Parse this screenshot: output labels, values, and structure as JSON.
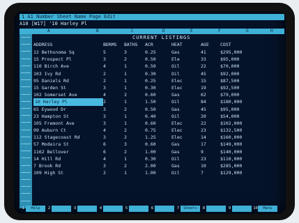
{
  "status_line": "1 A1  Number  Sheet  Name  Page  Edit",
  "cell_ref": "A10  [W17]  '10 Harley Pl",
  "columns": [
    "A",
    "B",
    "C",
    "D",
    "E",
    "F",
    "G",
    "H"
  ],
  "title": "CURRENT LISTINGS",
  "headers": [
    "ADDRESS",
    "BDRMS",
    "BATHS",
    "ACR",
    "HEAT",
    "AGE",
    "COST"
  ],
  "rows": [
    [
      "12 Bethsnoma Sq",
      "5",
      "3",
      "0.25",
      "Gas",
      "41",
      "$295,000"
    ],
    [
      "15 Prospect Pl",
      "3",
      "2",
      "0.50",
      "Ele",
      "33",
      "$95,000"
    ],
    [
      "110 Birch Ave",
      "4",
      "1",
      "0.50",
      "Oil",
      "22",
      "$70,000"
    ],
    [
      "103 Ivy Rd",
      "2",
      "1",
      "0.30",
      "Oil",
      "45",
      "$92,000"
    ],
    [
      "95 Daniels Rd",
      "2",
      "1",
      "0.25",
      "Elec",
      "15",
      "$87,500"
    ],
    [
      "15 Garden St",
      "3",
      "1",
      "0.30",
      "Elec",
      "19",
      "$92,500"
    ],
    [
      "102 Somerset Ave",
      "4",
      "2",
      "0.60",
      "Gas",
      "62",
      "$79,000"
    ],
    [
      "10 Harley Pl",
      "2",
      "1",
      "1.50",
      "Oil",
      "84",
      "$180,000"
    ],
    [
      "65 Eywood Dr",
      "3",
      "2",
      "0.50",
      "Gas",
      "45",
      "$95,000"
    ],
    [
      "23 Hampton St",
      "3",
      "1",
      "0.40",
      "Oil",
      "20",
      "$54,000"
    ],
    [
      "105 Fremont Ave",
      "3",
      "1",
      "0.60",
      "Elec",
      "22",
      "$102,000"
    ],
    [
      "99 Auburn Ct",
      "4",
      "2",
      "0.75",
      "Elec",
      "23",
      "$132,500"
    ],
    [
      "112 Stagecoast Rd",
      "3",
      "2",
      "1.25",
      "Elec",
      "14",
      "$160,000"
    ],
    [
      "57 Modeira St",
      "6",
      "3",
      "0.60",
      "Gas",
      "17",
      "$149,000"
    ],
    [
      "1162 Bellover",
      "6",
      "2",
      "1.00",
      "Gas",
      "9",
      "$140,000"
    ],
    [
      "14 Hill Rd",
      "4",
      "1",
      "0.30",
      "Oil",
      "23",
      "$110,000"
    ],
    [
      "7 Brook Rd",
      "3",
      "2",
      "2.00",
      "Gas",
      "10",
      "$285,000"
    ],
    [
      "109 High St",
      "2",
      "1",
      "1.00",
      "Oil",
      "7",
      "$129,000"
    ]
  ],
  "highlighted_row": 7,
  "fkeys": [
    {
      "num": "1",
      "label": "Help"
    },
    {
      "num": "2",
      "label": ""
    },
    {
      "num": "3",
      "label": ""
    },
    {
      "num": "4",
      "label": ""
    },
    {
      "num": "5",
      "label": ""
    },
    {
      "num": "6",
      "label": ""
    },
    {
      "num": "7",
      "label": "Sheets"
    },
    {
      "num": "8",
      "label": ""
    },
    {
      "num": "9",
      "label": ""
    },
    {
      "num": "10",
      "label": "Menu"
    }
  ]
}
